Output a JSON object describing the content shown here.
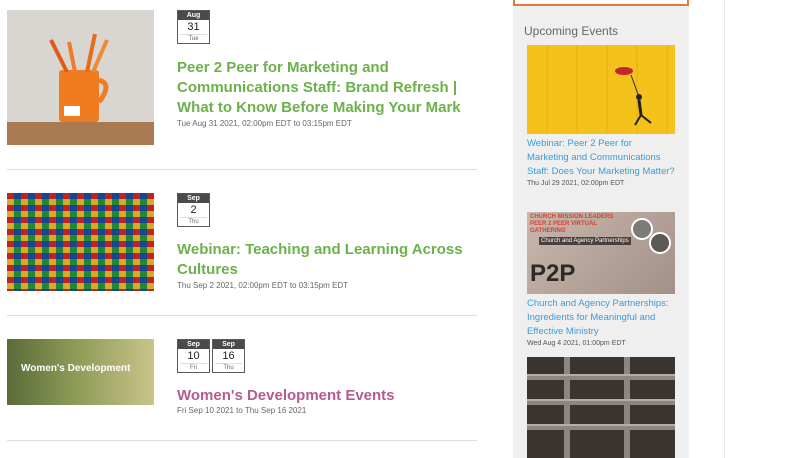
{
  "events": [
    {
      "dates": [
        {
          "month": "Aug",
          "day": "31",
          "weekday": "Tue"
        }
      ],
      "title": "Peer 2 Peer for Marketing and Communications Staff: Brand Refresh | What to Know Before Making Your Mark",
      "when": "Tue Aug 31 2021, 02:00pm EDT to 03:15pm EDT"
    },
    {
      "dates": [
        {
          "month": "Sep",
          "day": "2",
          "weekday": "Thu"
        }
      ],
      "title": "Webinar: Teaching and Learning Across Cultures",
      "when": "Thu Sep 2 2021, 02:00pm EDT to 03:15pm EDT"
    },
    {
      "dates": [
        {
          "month": "Sep",
          "day": "10",
          "weekday": "Fri"
        },
        {
          "month": "Sep",
          "day": "16",
          "weekday": "Thu"
        }
      ],
      "title": "Women's Development Events",
      "when": "Fri Sep 10 2021 to Thu Sep 16 2021",
      "thumb_text": "Women's Development"
    }
  ],
  "sidebar": {
    "heading": "Upcoming Events",
    "items": [
      {
        "title": "Webinar: Peer 2 Peer for Marketing and Communications Staff: Does Your Marketing Matter?",
        "date": "Thu Jul 29 2021, 02:00pm EDT"
      },
      {
        "title": "Church and Agency Partnerships: Ingredients for Meaningful and Effective Ministry",
        "date": "Wed Aug 4 2021, 01:00pm EDT",
        "img_text_top": "CHURCH MISSION LEADERS PEER 2 PEER VIRTUAL GATHERING",
        "img_text_mid": "Church and Agency Partnerships",
        "img_text_big": "P2P"
      },
      {
        "title": "",
        "date": ""
      }
    ]
  },
  "colors": {
    "green_title": "#6bb24a",
    "pink_title": "#b45b92",
    "link_blue": "#3b9bd7",
    "accent_orange": "#e27a3f"
  }
}
